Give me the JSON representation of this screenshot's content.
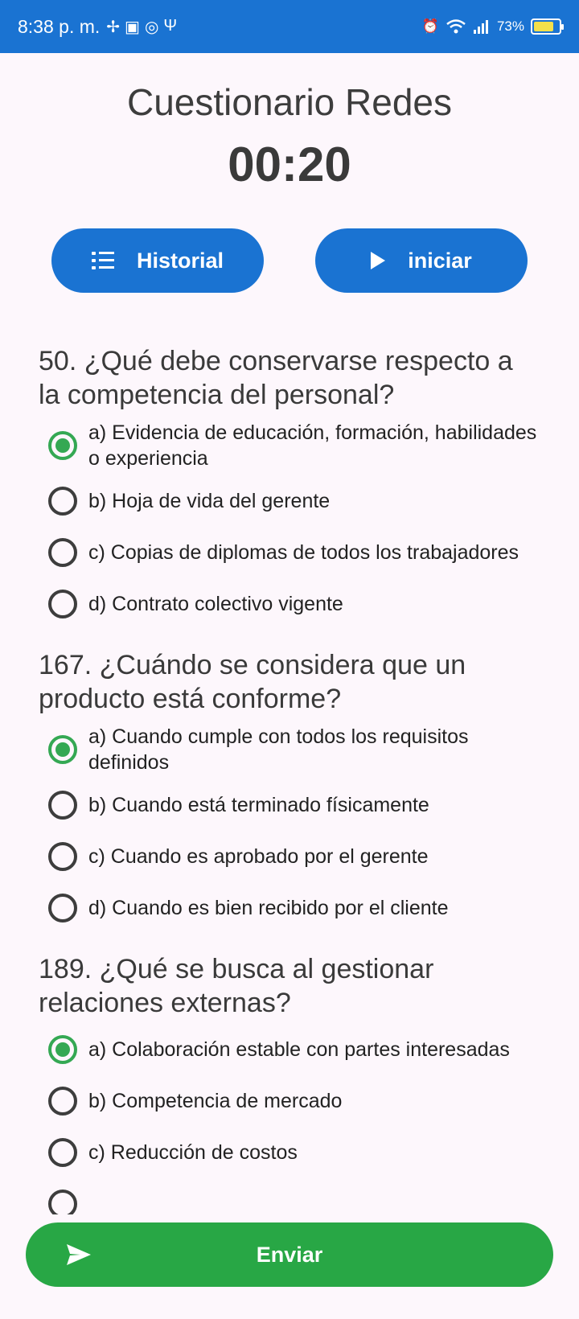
{
  "status_bar": {
    "time": "8:38 p. m.",
    "battery": "73%",
    "left_icons": [
      "fan-icon",
      "image-icon",
      "vpn-icon",
      "usb-icon"
    ],
    "right_icons": [
      "alarm-icon",
      "wifi-icon",
      "signal-icon",
      "battery-charging-icon"
    ]
  },
  "header": {
    "title": "Cuestionario Redes",
    "timer": "00:20"
  },
  "buttons": {
    "historial": "Historial",
    "iniciar": "iniciar",
    "enviar": "Enviar"
  },
  "questions": [
    {
      "text": "50. ¿Qué debe conservarse respecto a la competencia del personal?",
      "selected": 0,
      "options": [
        "a) Evidencia de educación, formación, habilidades o experiencia",
        "b) Hoja de vida del gerente",
        "c) Copias de diplomas de todos los trabajadores",
        "d) Contrato colectivo vigente"
      ]
    },
    {
      "text": "167. ¿Cuándo se considera que un producto está conforme?",
      "selected": 0,
      "options": [
        "a) Cuando cumple con todos los requisitos definidos",
        "b) Cuando está terminado físicamente",
        "c) Cuando es aprobado por el gerente",
        "d) Cuando es bien recibido por el cliente"
      ]
    },
    {
      "text": "189. ¿Qué se busca al gestionar relaciones externas?",
      "selected": 0,
      "options": [
        "a) Colaboración estable con partes interesadas",
        "b) Competencia de mercado",
        "c) Reducción de costos"
      ]
    }
  ],
  "colors": {
    "primary": "#1a73d2",
    "success": "#28a745",
    "radio_checked": "#34a853",
    "background": "#fdf7fc"
  }
}
